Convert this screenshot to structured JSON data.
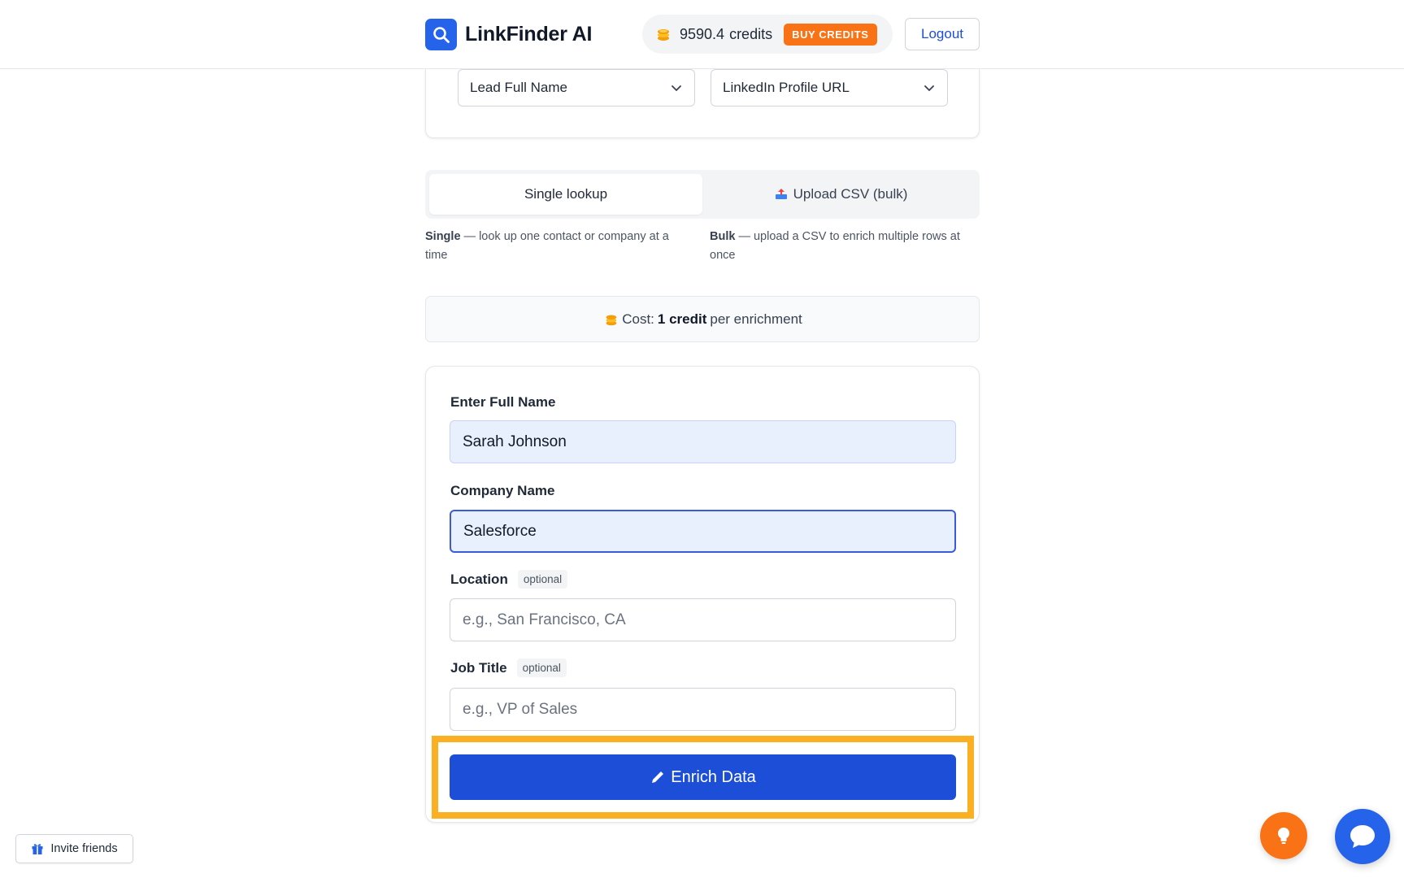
{
  "header": {
    "brand_name": "LinkFinder AI",
    "credits_value": "9590.4",
    "credits_label": "credits",
    "buy_credits": "BUY CREDITS",
    "logout": "Logout"
  },
  "mapping": {
    "select_name": "Lead Full Name",
    "select_linkedin": "LinkedIn Profile URL"
  },
  "tabs": {
    "single": "Single lookup",
    "bulk": "Upload CSV (bulk)"
  },
  "descriptions": {
    "single_title": "Single",
    "single_text": " — look up one contact or company at a time",
    "bulk_title": "Bulk",
    "bulk_text": " — upload a CSV to enrich multiple rows at once"
  },
  "cost": {
    "prefix": "Cost:",
    "amount": "1 credit",
    "suffix": "per enrichment"
  },
  "form": {
    "full_name_label": "Enter Full Name",
    "full_name_value": "Sarah Johnson",
    "company_label": "Company Name",
    "company_value": "Salesforce",
    "location_label": "Location",
    "location_placeholder": "e.g., San Francisco, CA",
    "job_title_label": "Job Title",
    "job_title_placeholder": "e.g., VP of Sales",
    "optional_tag": "optional",
    "enrich_button": "Enrich Data"
  },
  "footer": {
    "invite": "Invite friends"
  },
  "colors": {
    "primary": "#1d4ed8",
    "brand_blue": "#2563eb",
    "orange": "#f97316",
    "highlight": "#fbb024"
  }
}
